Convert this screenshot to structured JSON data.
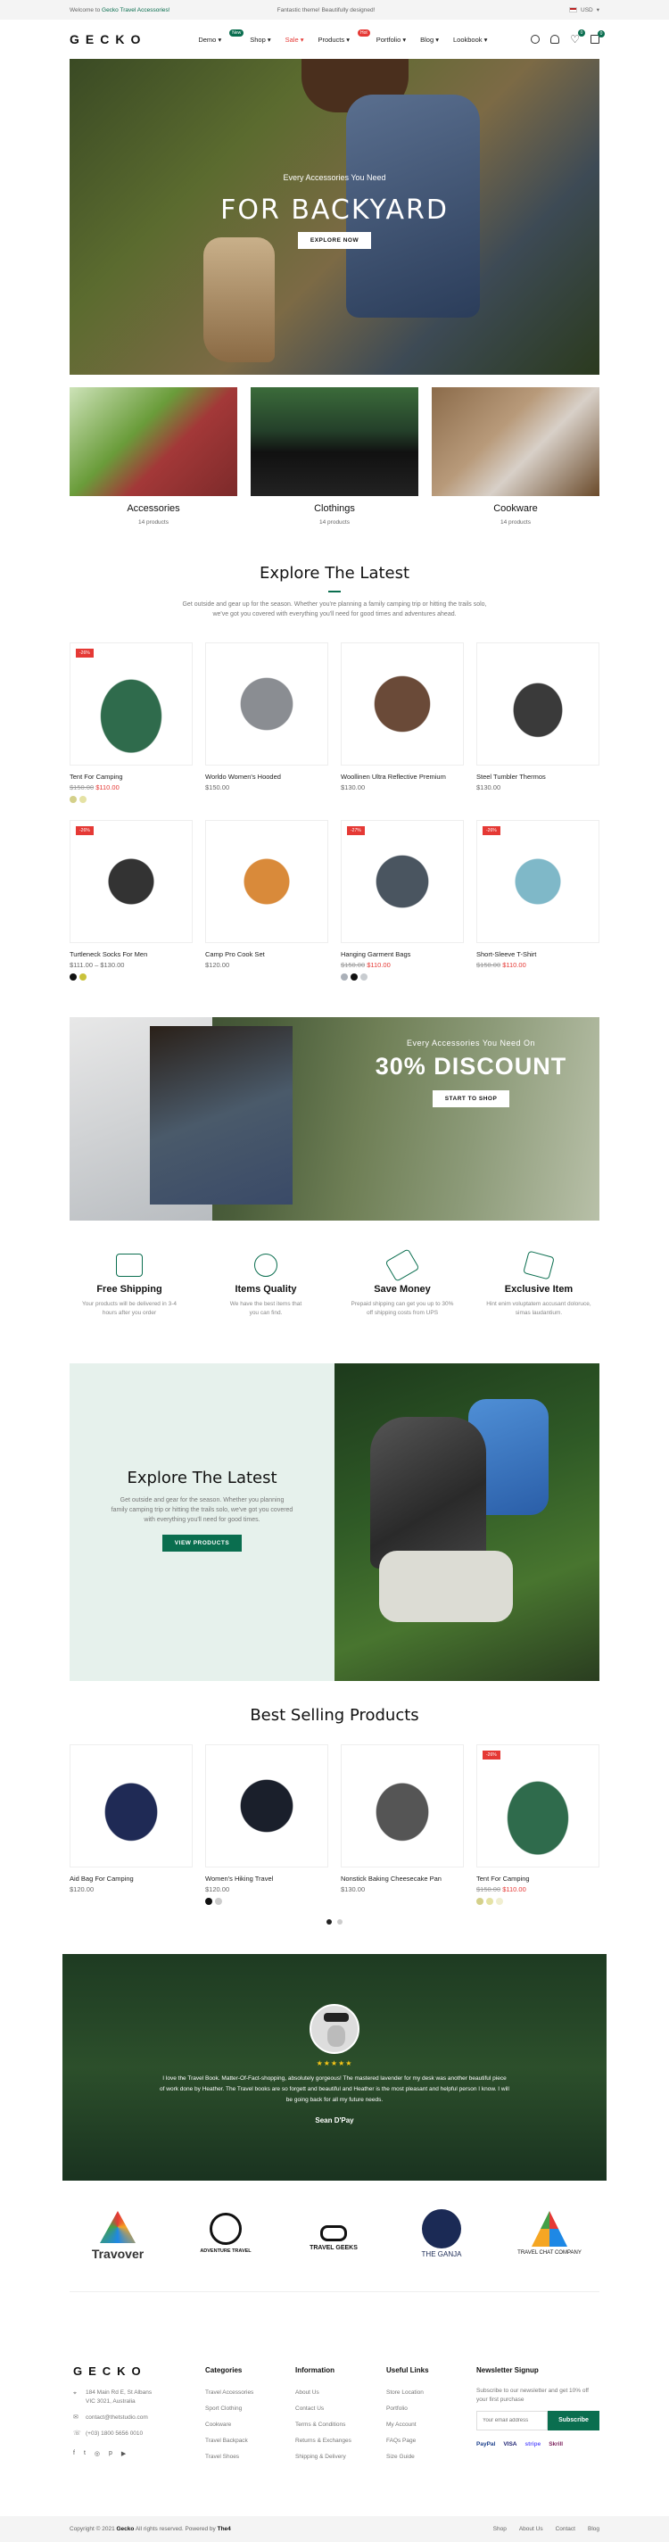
{
  "topbar": {
    "welcome_prefix": "Welcome to",
    "welcome_brand": "Gecko Travel Accessories!",
    "promo": "Fantastic theme! Beautifully designed!",
    "currency": "USD"
  },
  "header": {
    "logo": "GECKO",
    "nav": [
      {
        "label": "Demo",
        "badge": "New",
        "badge_color": "#0a6e4f"
      },
      {
        "label": "Shop",
        "badge": "",
        "badge_color": ""
      },
      {
        "label": "Sale",
        "badge": "",
        "badge_color": "",
        "color": "#e53935"
      },
      {
        "label": "Products",
        "badge": "Hot",
        "badge_color": "#e53935"
      },
      {
        "label": "Portfolio",
        "badge": "",
        "badge_color": ""
      },
      {
        "label": "Blog",
        "badge": "",
        "badge_color": ""
      },
      {
        "label": "Lookbook",
        "badge": "",
        "badge_color": ""
      }
    ],
    "wishlist_count": "0",
    "cart_count": "0"
  },
  "hero": {
    "subtitle": "Every Accessories You Need",
    "title": "FOR BACKYARD",
    "button": "EXPLORE NOW"
  },
  "categories": [
    {
      "name": "Accessories",
      "count": "14 products"
    },
    {
      "name": "Clothings",
      "count": "14 products"
    },
    {
      "name": "Cookware",
      "count": "14 products"
    }
  ],
  "latest": {
    "title": "Explore The Latest",
    "desc1": "Get outside and gear up for the season. Whether you're planning a family camping trip or hitting the trails solo,",
    "desc2": "we've got you covered with everything you'll need for good times and adventures ahead."
  },
  "products": [
    {
      "name": "Tent For Camping",
      "old": "$150.00",
      "price": "$110.00",
      "sale": "-26%",
      "swatches": [
        "#d4d08a",
        "#e5e2a4"
      ]
    },
    {
      "name": "Worldo Women's Hooded",
      "old": "",
      "price": "$150.00",
      "sale": "",
      "swatches": []
    },
    {
      "name": "Woollinen Ultra Reflective Premium",
      "old": "",
      "price": "$130.00",
      "sale": "",
      "swatches": []
    },
    {
      "name": "Steel Tumbler Thermos",
      "old": "",
      "price": "$130.00",
      "sale": "",
      "swatches": []
    },
    {
      "name": "Turtleneck Socks For Men",
      "old": "",
      "price": "$111.00 – $130.00",
      "sale": "-26%",
      "swatches": [
        "#111111",
        "#c9c23a"
      ]
    },
    {
      "name": "Camp Pro Cook Set",
      "old": "",
      "price": "$120.00",
      "sale": "",
      "swatches": []
    },
    {
      "name": "Hanging Garment Bags",
      "old": "$150.00",
      "price": "$110.00",
      "sale": "-27%",
      "swatches": [
        "#aab0b8",
        "#111111",
        "#c8ccd0"
      ]
    },
    {
      "name": "Short-Sleeve T-Shirt",
      "old": "$150.00",
      "price": "$110.00",
      "sale": "-26%",
      "swatches": []
    }
  ],
  "discount_banner": {
    "subtitle": "Every Accessories You Need On",
    "title": "30% DISCOUNT",
    "button": "START TO SHOP"
  },
  "features": [
    {
      "title": "Free Shipping",
      "d1": "Your products will be delivered in 3-4",
      "d2": "hours after you order"
    },
    {
      "title": "Items Quality",
      "d1": "We have the best items that",
      "d2": "you can find."
    },
    {
      "title": "Save Money",
      "d1": "Prepaid shipping can get you up to 30%",
      "d2": "off shipping costs from UPS"
    },
    {
      "title": "Exclusive Item",
      "d1": "Hint enim voluptatem accusant doloruce,",
      "d2": "simas laudantium."
    }
  ],
  "explore": {
    "title": "Explore The Latest",
    "d1": "Get outside and gear for the season. Whether you planning",
    "d2": "family camping trip or hitting the trails solo, we've got you covered",
    "d3": "with everything you'll need for good times.",
    "button": "VIEW PRODUCTS"
  },
  "best": {
    "title": "Best Selling Products",
    "items": [
      {
        "name": "Aid Bag For Camping",
        "old": "",
        "price": "$120.00",
        "sale": "",
        "swatches": []
      },
      {
        "name": "Women's Hiking Travel",
        "old": "",
        "price": "$120.00",
        "sale": "",
        "swatches": [
          "#111111",
          "#cccccc"
        ]
      },
      {
        "name": "Nonstick Baking Cheesecake Pan",
        "old": "",
        "price": "$130.00",
        "sale": "",
        "swatches": []
      },
      {
        "name": "Tent For Camping",
        "old": "$150.00",
        "price": "$110.00",
        "sale": "-26%",
        "swatches": [
          "#d4d08a",
          "#e5e2a4",
          "#f0eed0"
        ]
      }
    ]
  },
  "testimonial": {
    "stars": "★★★★★",
    "q1": "I love the Travel Book. Matter-Of-Fact-shopping, absolutely gorgeous! The mastered lavender for my desk was another beautiful piece",
    "q2": "of work done by Heather. The Travel books are so forgett and beautiful and Heather is the most pleasant and helpful person I know. I will",
    "q3": "be going back for all my future needs.",
    "author": "Sean D'Pay"
  },
  "brands": [
    "Travover",
    "ADVENTURE TRAVEL",
    "TRAVEL GEEKS",
    "THE GANJA",
    "TRAVEL CHAT COMPANY"
  ],
  "footer": {
    "logo": "GECKO",
    "address1": "184 Main Rd E, St Albans",
    "address2": "VIC 3021, Australia",
    "email": "contact@thetstudio.com",
    "phone": "(+03) 1800 5656 0010",
    "cols": [
      {
        "title": "Categories",
        "links": [
          "Travel Accessories",
          "Sport Clothing",
          "Cookware",
          "Travel Backpack",
          "Travel Shoes"
        ]
      },
      {
        "title": "Information",
        "links": [
          "About Us",
          "Contact Us",
          "Terms & Conditions",
          "Returns & Exchanges",
          "Shipping & Delivery"
        ]
      },
      {
        "title": "Useful Links",
        "links": [
          "Store Location",
          "Portfolio",
          "My Account",
          "FAQs Page",
          "Size Guide"
        ]
      }
    ],
    "newsletter_title": "Newsletter Signup",
    "newsletter_d1": "Subscribe to our newsletter and get 10% off",
    "newsletter_d2": "your first purchase",
    "email_placeholder": "Your email address",
    "subscribe": "Subscribe",
    "payments": [
      "PayPal",
      "VISA",
      "stripe",
      "Skrill"
    ]
  },
  "copyright": {
    "prefix": "Copyright © 2021",
    "brand": "Gecko",
    "suffix": "All rights reserved. Powered by",
    "powered": "The4",
    "links": [
      "Shop",
      "About Us",
      "Contact",
      "Blog"
    ]
  }
}
